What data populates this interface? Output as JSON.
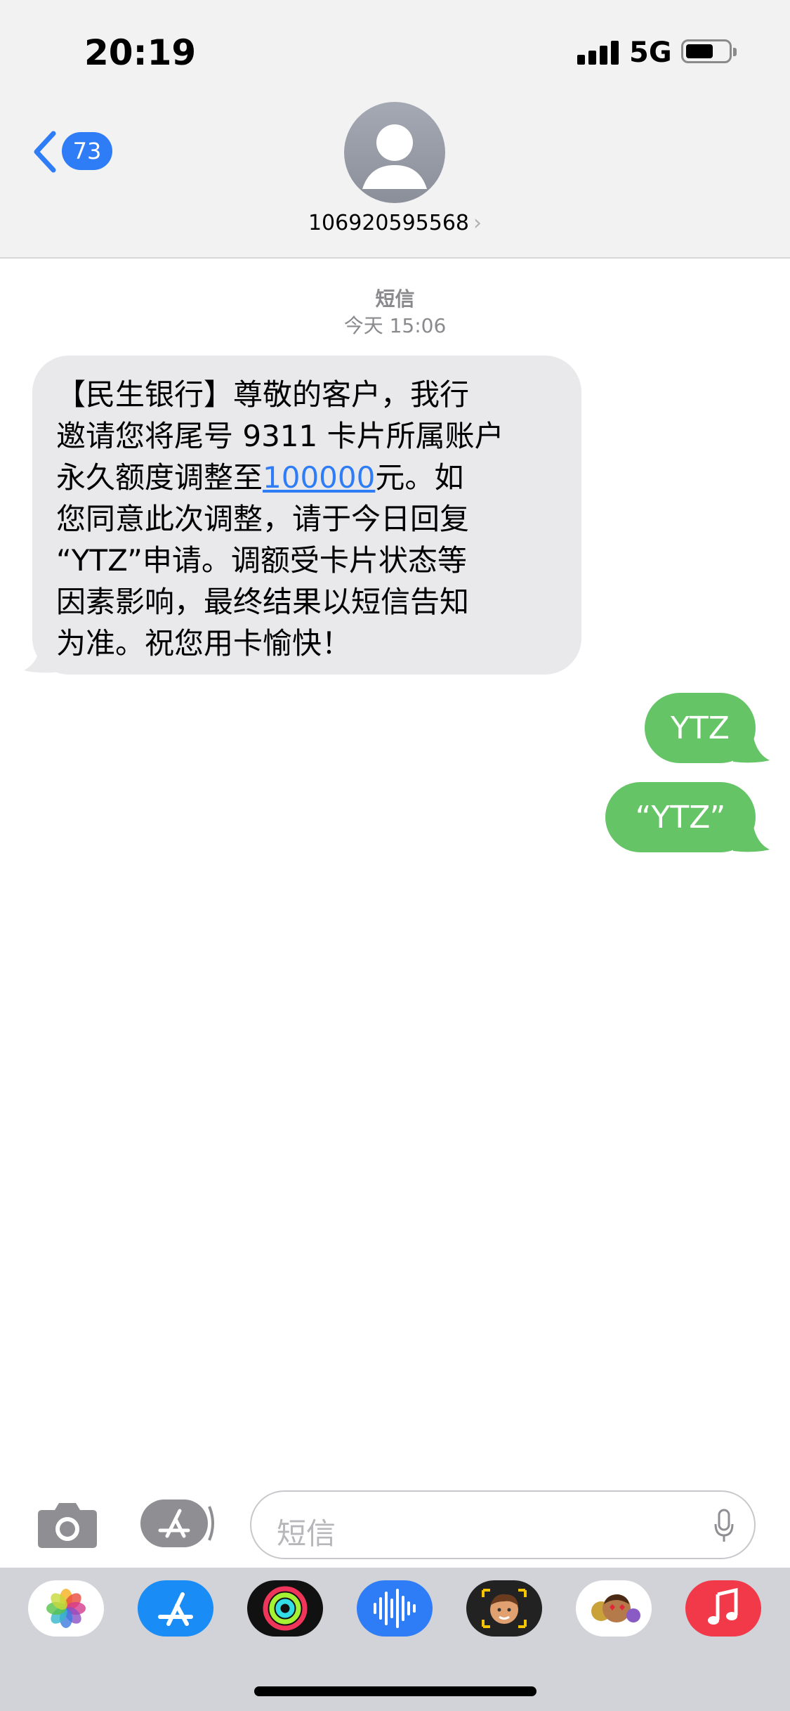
{
  "status_bar": {
    "time": "20:19",
    "network": "5G"
  },
  "nav": {
    "back_badge": "73",
    "contact_number": "106920595568",
    "chevron": "›"
  },
  "thread_meta": {
    "service": "短信",
    "timestamp": "今天 15:06"
  },
  "messages": {
    "incoming": [
      {
        "lines": [
          "【民生银行】尊敬的客户，我行",
          "邀请您将尾号 9311 卡片所属账户",
          "永久额度调整至",
          "100000",
          "元。如",
          "您同意此次调整，请于今日回复",
          "“YTZ”申请。调额受卡片状态等",
          "因素影响，最终结果以短信告知",
          "为准。祝您用卡愉快！"
        ]
      }
    ],
    "outgoing": [
      "YTZ",
      "“YTZ”"
    ]
  },
  "composer": {
    "placeholder": "短信"
  },
  "dock": {
    "apps": [
      "photos-icon",
      "app-store-icon",
      "activity-icon",
      "voice-memos-icon",
      "memoji-icon",
      "animoji-stickers-icon",
      "music-icon"
    ]
  },
  "colors": {
    "accent": "#2f7df6",
    "sms_green": "#65c466",
    "incoming_gray": "#e9e9eb"
  }
}
